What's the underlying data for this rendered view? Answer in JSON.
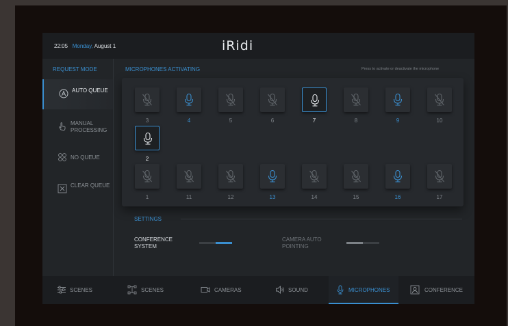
{
  "header": {
    "time": "22:05",
    "date_day": "Monday,",
    "date_rest": "August 1",
    "logo": "iRidi"
  },
  "request_mode": {
    "title": "REQUEST MODE",
    "items": [
      {
        "label": "AUTO QUEUE",
        "icon": "auto-queue-icon",
        "active": true
      },
      {
        "label": "MANUAL PROCESSING",
        "icon": "hand-pointer-icon",
        "active": false
      },
      {
        "label": "NO QUEUE",
        "icon": "no-queue-icon",
        "active": false
      },
      {
        "label": "CLEAR QUEUE",
        "icon": "clear-queue-icon",
        "active": false
      }
    ]
  },
  "microphones": {
    "title": "MICROPHONES ACTIVATING",
    "hint": "Press to activate or deactivate the microphone",
    "rows": [
      [
        {
          "num": "3",
          "state": "muted"
        },
        {
          "num": "4",
          "state": "on"
        },
        {
          "num": "5",
          "state": "muted"
        },
        {
          "num": "6",
          "state": "muted"
        },
        {
          "num": "7",
          "state": "selected"
        },
        {
          "num": "8",
          "state": "muted"
        },
        {
          "num": "9",
          "state": "on"
        },
        {
          "num": "10",
          "state": "muted"
        }
      ],
      [
        {
          "num": "2",
          "state": "selected"
        }
      ],
      [
        {
          "num": "1",
          "state": "muted"
        },
        {
          "num": "11",
          "state": "muted"
        },
        {
          "num": "12",
          "state": "muted"
        },
        {
          "num": "13",
          "state": "on"
        },
        {
          "num": "14",
          "state": "muted"
        },
        {
          "num": "15",
          "state": "muted"
        },
        {
          "num": "16",
          "state": "on"
        },
        {
          "num": "17",
          "state": "muted"
        }
      ]
    ]
  },
  "settings": {
    "title": "SETTINGS",
    "conference_system": {
      "label_line1": "CONFERENCE",
      "label_line2": "SYSTEM",
      "value": 0.5
    },
    "camera_auto_pointing": {
      "label_line1": "CAMERA AUTO",
      "label_line2": "POINTING",
      "value": 0.5
    }
  },
  "nav": [
    {
      "label": "SCENES",
      "icon": "sliders-icon",
      "active": false
    },
    {
      "label": "SCENES",
      "icon": "scene-nodes-icon",
      "active": false
    },
    {
      "label": "CAMERAS",
      "icon": "camera-icon",
      "active": false
    },
    {
      "label": "SOUND",
      "icon": "speaker-icon",
      "active": false
    },
    {
      "label": "MICROPHONES",
      "icon": "microphone-icon",
      "active": true
    },
    {
      "label": "CONFERENCE",
      "icon": "conference-icon",
      "active": false
    }
  ],
  "colors": {
    "accent": "#3a8fd0",
    "panel": "#222528",
    "tile": "#2b2e32"
  }
}
